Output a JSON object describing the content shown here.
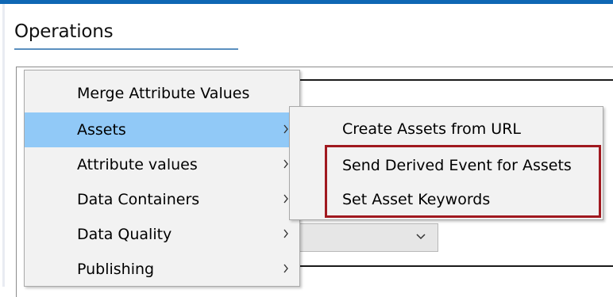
{
  "section": {
    "title": "Operations"
  },
  "context_menu": {
    "items": [
      {
        "label": "Merge Attribute Values",
        "has_submenu": false,
        "highlighted": false
      },
      {
        "label": "Assets",
        "has_submenu": true,
        "highlighted": true
      },
      {
        "label": "Attribute values",
        "has_submenu": true,
        "highlighted": false
      },
      {
        "label": "Data Containers",
        "has_submenu": true,
        "highlighted": false
      },
      {
        "label": "Data Quality",
        "has_submenu": true,
        "highlighted": false
      },
      {
        "label": "Publishing",
        "has_submenu": true,
        "highlighted": false
      }
    ]
  },
  "assets_submenu": {
    "items": [
      {
        "label": "Create Assets from URL"
      },
      {
        "label": "Send Derived Event for Assets"
      },
      {
        "label": "Set Asset Keywords"
      }
    ]
  },
  "icons": {
    "submenu_arrow": "chevron-right-icon",
    "dropdown": "chevron-down-icon"
  },
  "colors": {
    "top_bar": "#0f67b4",
    "menu_highlight": "#91c9f7",
    "annotation_box": "#a0191f",
    "menu_background": "#f2f2f2"
  }
}
